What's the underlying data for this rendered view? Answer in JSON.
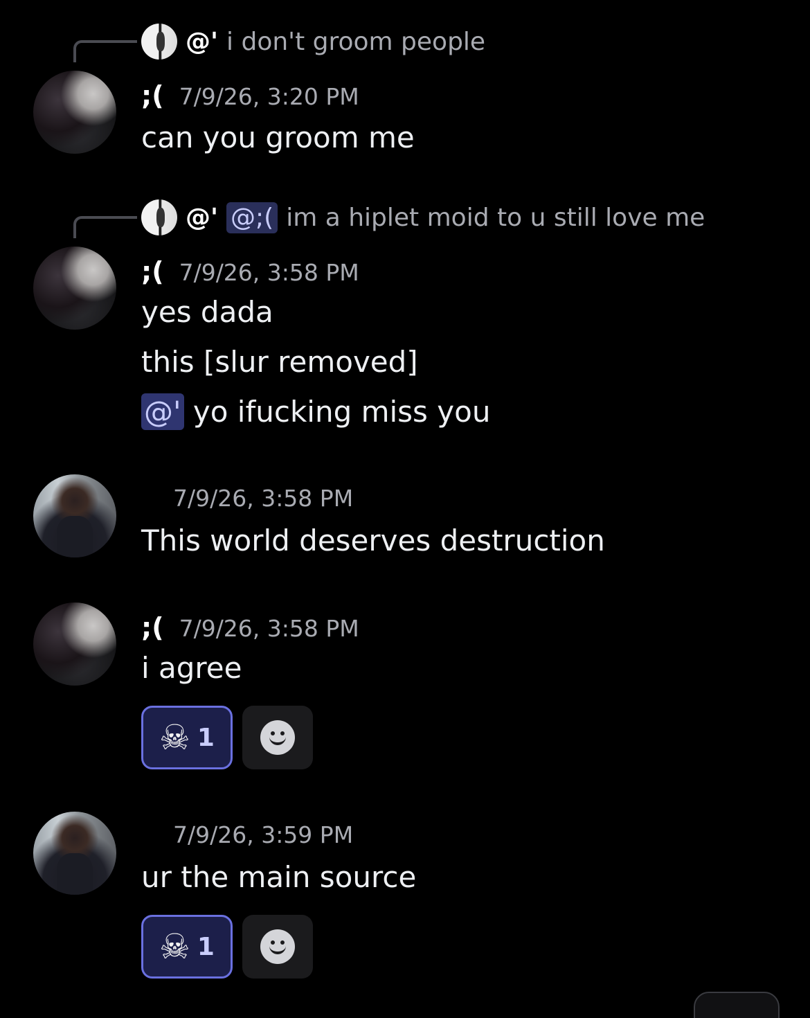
{
  "messages": [
    {
      "reply": {
        "author": "@'",
        "mention": "",
        "text": "i don't groom people"
      },
      "author": ";(",
      "time": "7/9/26, 3:20 PM",
      "lines": [
        "can you groom me"
      ]
    },
    {
      "reply": {
        "author": "@'",
        "mention": "@;(",
        "text": "im a hiplet moid to u still love me"
      },
      "author": ";(",
      "time": "7/9/26, 3:58 PM",
      "lines": [
        "yes dada",
        "this [slur removed]"
      ],
      "mention_line": {
        "mention": "@'",
        "text": " yo ifucking miss you"
      }
    },
    {
      "author": "",
      "time": "7/9/26, 3:58 PM",
      "lines": [
        "This world deserves destruction"
      ]
    },
    {
      "author": ";(",
      "time": "7/9/26, 3:58 PM",
      "lines": [
        "i agree"
      ],
      "reaction": {
        "emoji": "☠",
        "count": "1"
      }
    },
    {
      "author": "",
      "time": "7/9/26, 3:59 PM",
      "lines": [
        "ur the main source"
      ],
      "reaction": {
        "emoji": "☠",
        "count": "1"
      }
    }
  ],
  "icons": {
    "skull": "skull-and-crossbones",
    "add_reaction": "smiley-face"
  },
  "colors": {
    "background": "#000000",
    "mention_bg": "#2f3570",
    "reaction_border": "#6a70e0",
    "reaction_bg": "#1c1f4a"
  }
}
